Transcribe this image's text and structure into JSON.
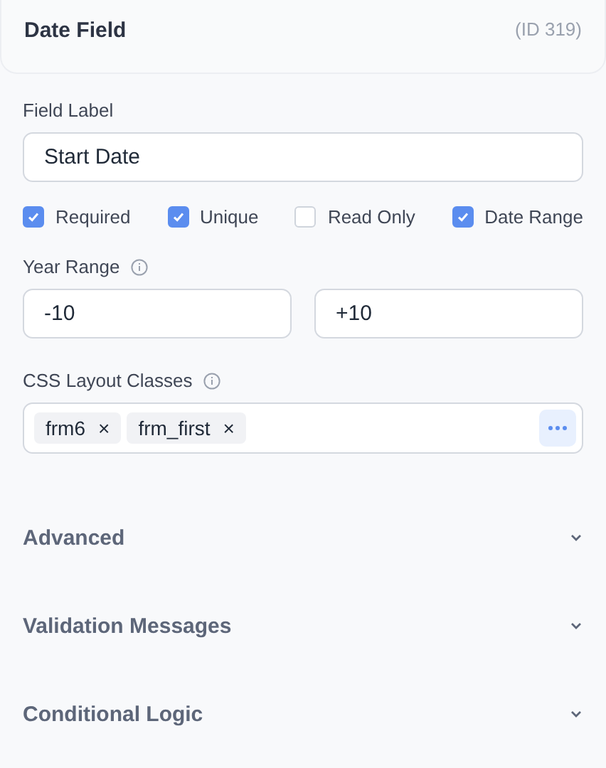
{
  "header": {
    "title": "Date Field",
    "id_text": "(ID 319)"
  },
  "field_label": {
    "label": "Field Label",
    "value": "Start Date"
  },
  "options": [
    {
      "label": "Required",
      "checked": true
    },
    {
      "label": "Unique",
      "checked": true
    },
    {
      "label": "Read Only",
      "checked": false
    },
    {
      "label": "Date Range",
      "checked": true
    }
  ],
  "year_range": {
    "label": "Year Range",
    "from": "-10",
    "to": "+10"
  },
  "css_classes": {
    "label": "CSS Layout Classes",
    "tags": [
      "frm6",
      "frm_first"
    ],
    "remove_symbol": "×"
  },
  "sections": [
    {
      "title": "Advanced",
      "expanded": false
    },
    {
      "title": "Validation Messages",
      "expanded": false
    },
    {
      "title": "Conditional Logic",
      "expanded": false
    }
  ]
}
